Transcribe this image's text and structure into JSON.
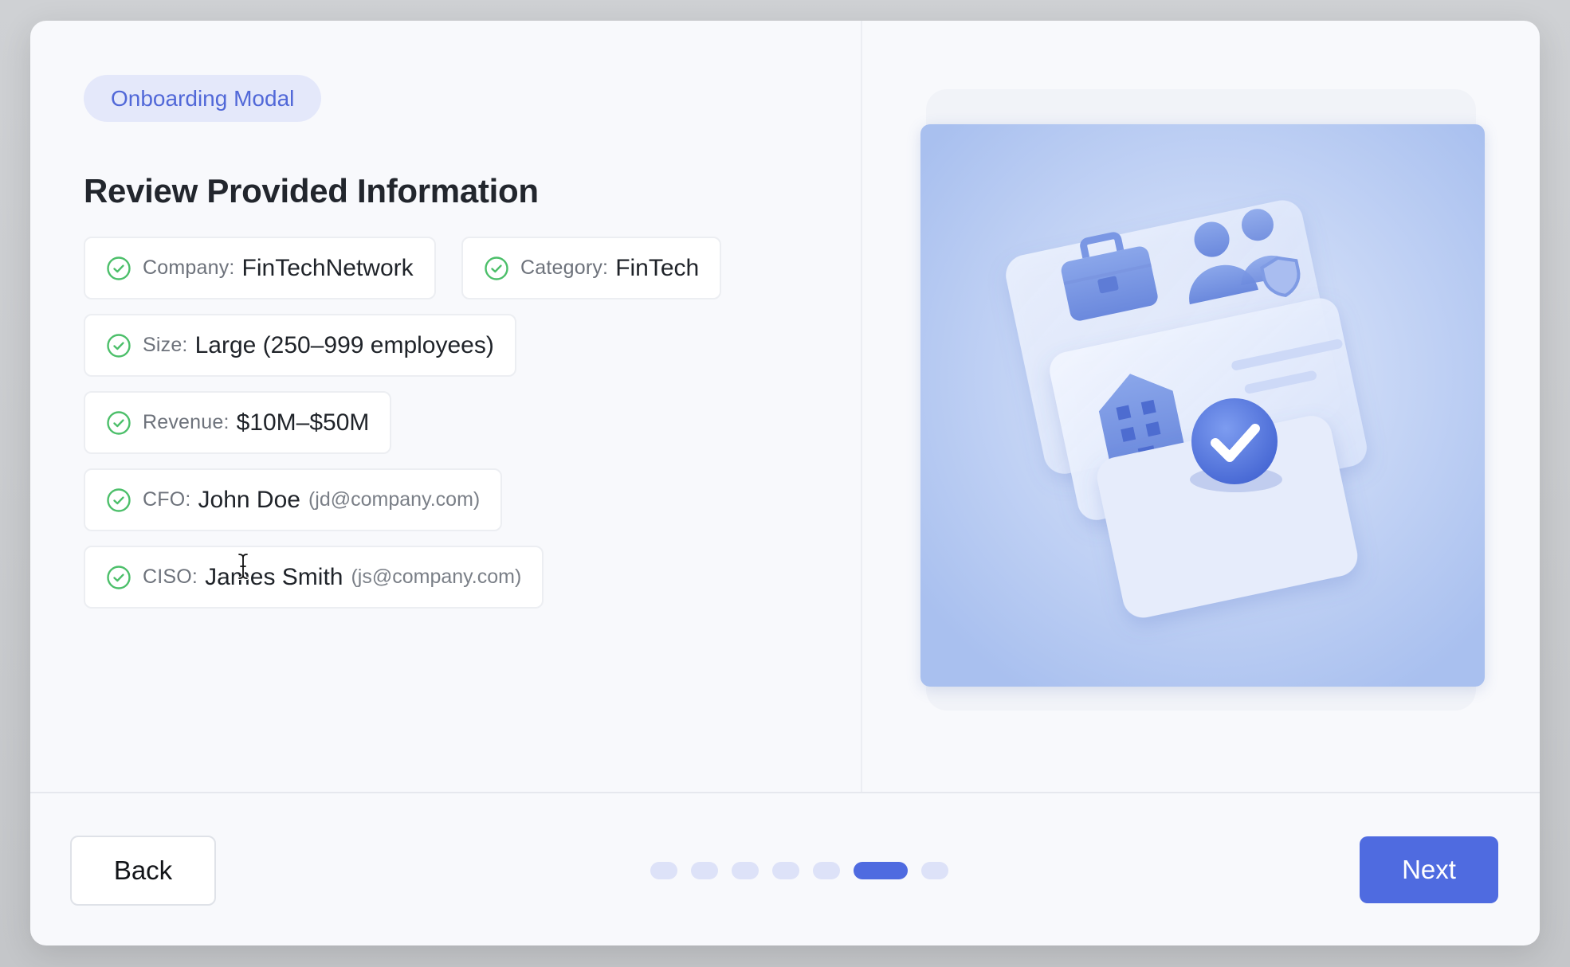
{
  "modal": {
    "badge_label": "Onboarding Modal",
    "title": "Review Provided Information"
  },
  "fields": {
    "company": {
      "label": "Company:",
      "value": "FinTechNetwork"
    },
    "category": {
      "label": "Category:",
      "value": "FinTech"
    },
    "size": {
      "label": "Size:",
      "value": "Large (250–999 employees)"
    },
    "revenue": {
      "label": "Revenue:",
      "value": "$10M–$50M"
    },
    "cfo": {
      "label": "CFO:",
      "value": "John Doe",
      "email": "(jd@company.com)"
    },
    "ciso": {
      "label": "CISO:",
      "value": "James Smith",
      "email": "(js@company.com)"
    }
  },
  "footer": {
    "back_label": "Back",
    "next_label": "Next",
    "steps_total": 7,
    "current_step": 6
  },
  "illustration": {
    "icons": [
      "briefcase-icon",
      "users-shield-icon",
      "building-icon",
      "dollar-icon",
      "checkmark-icon"
    ],
    "currency_symbol": "$"
  },
  "colors": {
    "accent": "#4f6be0",
    "check_green": "#4cbf6a",
    "badge_bg": "#e4e8fa",
    "badge_text": "#5168d8",
    "illustration_bg": "#b5c8f2"
  }
}
